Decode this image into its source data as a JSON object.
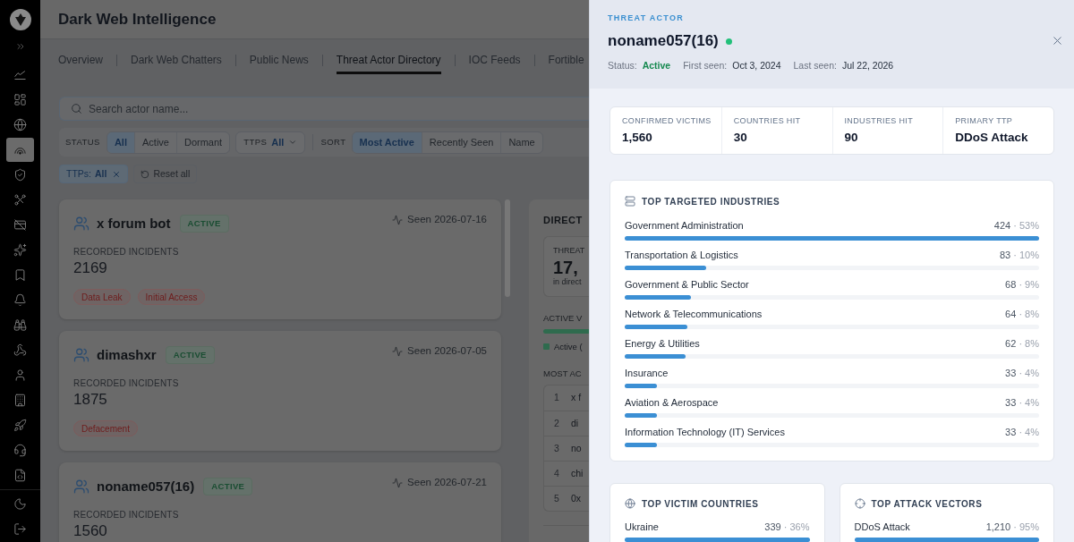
{
  "sidebar": {
    "items": [
      {
        "selected": false
      },
      {
        "selected": false
      },
      {
        "selected": false
      },
      {
        "selected": true
      },
      {
        "selected": false
      },
      {
        "selected": false
      },
      {
        "selected": false
      },
      {
        "selected": false
      },
      {
        "selected": false
      },
      {
        "selected": false
      },
      {
        "selected": false
      },
      {
        "selected": false
      },
      {
        "selected": false
      },
      {
        "selected": false
      },
      {
        "selected": false
      },
      {
        "selected": false
      },
      {
        "selected": false
      }
    ]
  },
  "header": {
    "title": "Dark Web Intelligence"
  },
  "tabs": [
    {
      "label": "Overview",
      "selected": false
    },
    {
      "label": "Dark Web Chatters",
      "selected": false
    },
    {
      "label": "Public News",
      "selected": false
    },
    {
      "label": "Threat Actor Directory",
      "selected": true
    },
    {
      "label": "IOC Feeds",
      "selected": false
    },
    {
      "label": "Fortible",
      "selected": false
    }
  ],
  "search": {
    "placeholder": "Search actor name..."
  },
  "filters": {
    "status": {
      "label": "STATUS",
      "options": [
        {
          "label": "All",
          "selected": true
        },
        {
          "label": "Active",
          "selected": false
        },
        {
          "label": "Dormant",
          "selected": false
        }
      ]
    },
    "ttps": {
      "label": "TTPS",
      "value": "All"
    },
    "sort": {
      "label": "SORT",
      "options": [
        {
          "label": "Most Active",
          "selected": true
        },
        {
          "label": "Recently Seen",
          "selected": false
        },
        {
          "label": "Name",
          "selected": false
        }
      ]
    }
  },
  "active_chips": [
    {
      "label": "TTPs:",
      "value": "All"
    }
  ],
  "reset": "Reset all",
  "actors": [
    {
      "name": "x forum bot",
      "badge": "ACTIVE",
      "seen": "Seen 2026-07-16",
      "incidents_label": "RECORDED INCIDENTS",
      "incidents": "2169",
      "tags": [
        "Data Leak",
        "Initial Access"
      ]
    },
    {
      "name": "dimashxr",
      "badge": "ACTIVE",
      "seen": "Seen 2026-07-05",
      "incidents_label": "RECORDED INCIDENTS",
      "incidents": "1875",
      "tags": [
        "Defacement"
      ]
    },
    {
      "name": "noname057(16)",
      "badge": "ACTIVE",
      "seen": "Seen 2026-07-21",
      "incidents_label": "RECORDED INCIDENTS",
      "incidents": "1560"
    }
  ],
  "directory_panel": {
    "title": "DIRECT",
    "stat": {
      "label": "THREAT",
      "value": "17,",
      "caption": "in direct"
    },
    "ratio_label": "ACTIVE V",
    "legend": "Active (",
    "list_label": "MOST AC",
    "rows": [
      {
        "rank": "1",
        "name": "x f"
      },
      {
        "rank": "2",
        "name": "di"
      },
      {
        "rank": "3",
        "name": "no"
      },
      {
        "rank": "4",
        "name": "chi"
      },
      {
        "rank": "5",
        "name": "0x"
      }
    ]
  },
  "drawer": {
    "eyebrow": "THREAT ACTOR",
    "name": "noname057(16)",
    "online": true,
    "meta": [
      {
        "label": "Status:",
        "value": "Active",
        "kind": "status"
      },
      {
        "label": "First seen:",
        "value": "Oct 3, 2024",
        "kind": "date"
      },
      {
        "label": "Last seen:",
        "value": "Jul 22, 2026",
        "kind": "date"
      }
    ],
    "stats": [
      {
        "label": "CONFIRMED VICTIMS",
        "value": "1,560"
      },
      {
        "label": "COUNTRIES HIT",
        "value": "30"
      },
      {
        "label": "INDUSTRIES HIT",
        "value": "90"
      },
      {
        "label": "PRIMARY TTP",
        "value": "DDoS Attack"
      }
    ],
    "industries": {
      "title": "TOP TARGETED INDUSTRIES",
      "items": [
        {
          "name": "Government Administration",
          "count": "424",
          "share": "· 53%",
          "level": 1
        },
        {
          "name": "Transportation & Logistics",
          "count": "83",
          "share": "· 10%",
          "level": 0.196
        },
        {
          "name": "Government & Public Sector",
          "count": "68",
          "share": "· 9%",
          "level": 0.16
        },
        {
          "name": "Network & Telecommunications",
          "count": "64",
          "share": "· 8%",
          "level": 0.151
        },
        {
          "name": "Energy & Utilities",
          "count": "62",
          "share": "· 8%",
          "level": 0.146
        },
        {
          "name": "Insurance",
          "count": "33",
          "share": "· 4%",
          "level": 0.078
        },
        {
          "name": "Aviation & Aerospace",
          "count": "33",
          "share": "· 4%",
          "level": 0.078
        },
        {
          "name": "Information Technology (IT) Services",
          "count": "33",
          "share": "· 4%",
          "level": 0.078
        }
      ]
    },
    "countries": {
      "title": "TOP VICTIM COUNTRIES",
      "items": [
        {
          "name": "Ukraine",
          "count": "339",
          "share": "· 36%",
          "level": 1
        }
      ]
    },
    "vectors": {
      "title": "TOP ATTACK VECTORS",
      "items": [
        {
          "name": "DDoS Attack",
          "count": "1,210",
          "share": "· 95%",
          "level": 1
        }
      ]
    }
  }
}
